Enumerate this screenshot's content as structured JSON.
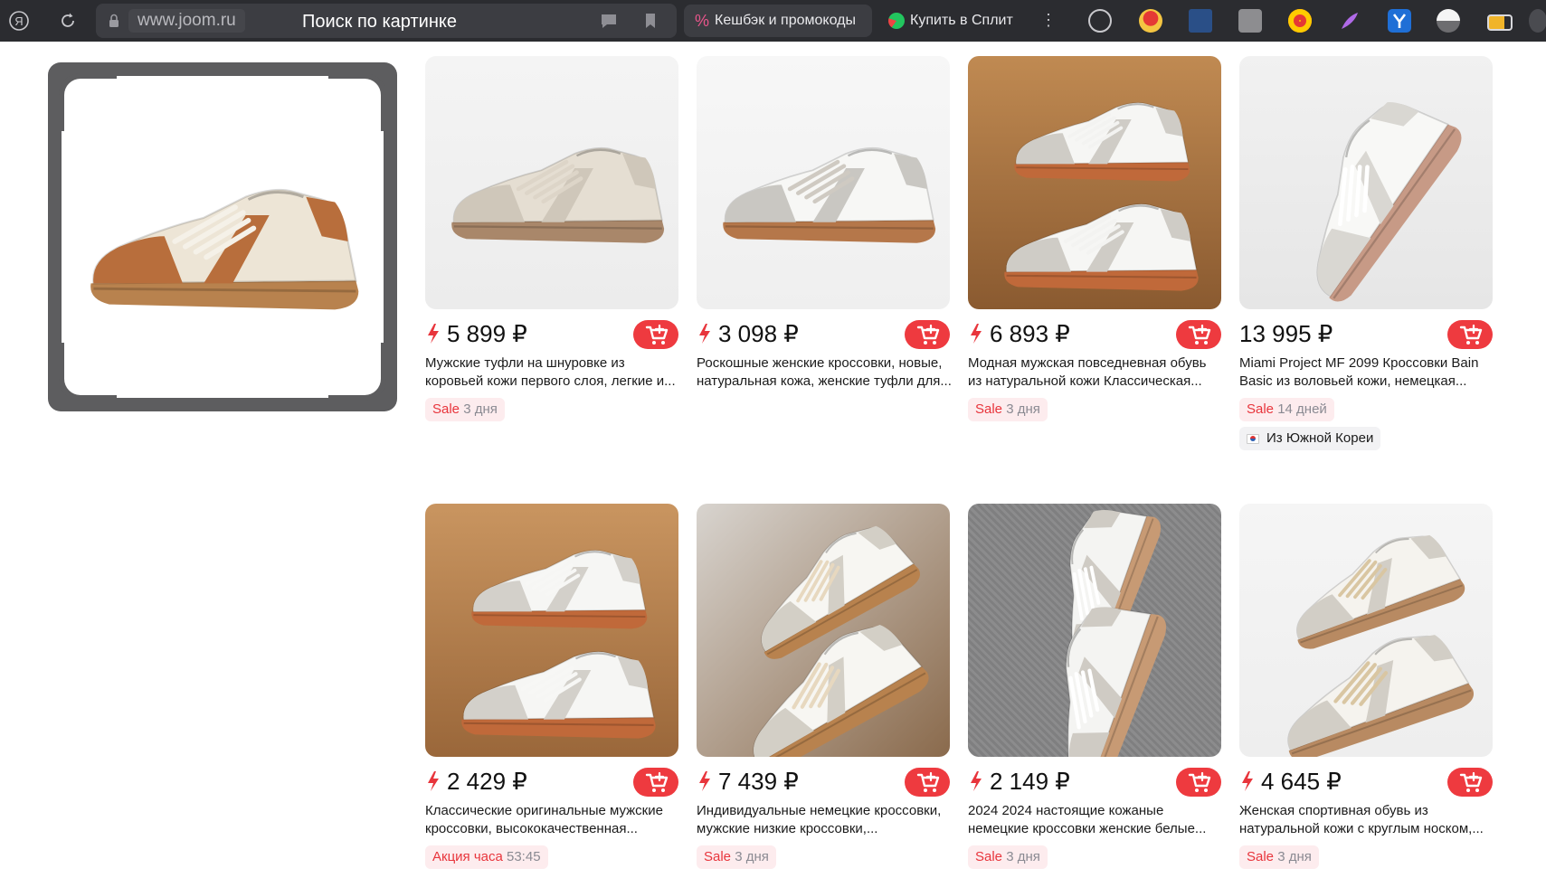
{
  "browser": {
    "domain": "www.joom.ru",
    "page_title": "Поиск по картинке",
    "cashback_label": "Кешбэк и промокоды",
    "split_label": "Купить в Сплит",
    "menu_glyph": "⋮",
    "yandex_glyph": "Я"
  },
  "colors": {
    "accent_red": "#ee3a3f",
    "sale_text": "#e8353c",
    "badge_bg": "#fdecee",
    "topbar_bg": "#2b2c30"
  },
  "products": [
    {
      "price": "5 899 ₽",
      "flash": true,
      "title": "Мужские туфли на шнуровке из коровьей кожи первого слоя, легкие и...",
      "badge_label": "Sale",
      "badge_time": "3 дня",
      "origin": ""
    },
    {
      "price": "3 098 ₽",
      "flash": true,
      "title": "Роскошные женские кроссовки, новые, натуральная кожа, женские туфли для...",
      "badge_label": "",
      "badge_time": "",
      "origin": ""
    },
    {
      "price": "6 893 ₽",
      "flash": true,
      "title": "Модная мужская повседневная обувь из натуральной кожи Классическая...",
      "badge_label": "Sale",
      "badge_time": "3 дня",
      "origin": ""
    },
    {
      "price": "13 995 ₽",
      "flash": false,
      "title": "Miami Project MF 2099 Кроссовки Bain Basic из воловьей кожи, немецкая...",
      "badge_label": "Sale",
      "badge_time": "14 дней",
      "origin": "Из Южной Кореи"
    },
    {
      "price": "2 429 ₽",
      "flash": true,
      "title": "Классические оригинальные мужские кроссовки, высококачественная...",
      "badge_label": "Акция часа",
      "badge_time": "53:45",
      "origin": ""
    },
    {
      "price": "7 439 ₽",
      "flash": true,
      "title": "Индивидуальные немецкие кроссовки, мужские низкие кроссовки,...",
      "badge_label": "Sale",
      "badge_time": "3 дня",
      "origin": ""
    },
    {
      "price": "2 149 ₽",
      "flash": true,
      "title": "2024 2024 настоящие кожаные немецкие кроссовки женские белые...",
      "badge_label": "Sale",
      "badge_time": "3 дня",
      "origin": ""
    },
    {
      "price": "4 645 ₽",
      "flash": true,
      "title": "Женская спортивная обувь из натуральной кожи с круглым носком,...",
      "badge_label": "Sale",
      "badge_time": "3 дня",
      "origin": ""
    }
  ]
}
